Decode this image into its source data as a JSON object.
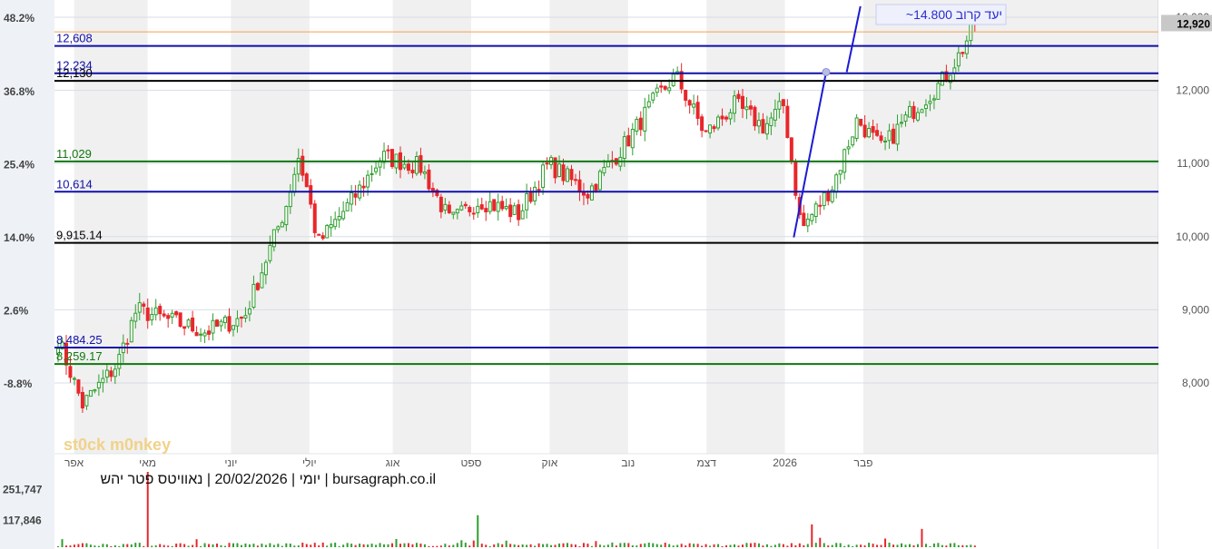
{
  "chart_data": {
    "type": "candlestick",
    "price_axis": {
      "ticks": [
        8000,
        9000,
        10000,
        11000,
        12000,
        13000
      ],
      "tick_labels": [
        "8,000",
        "9,000",
        "10,000",
        "11,000",
        "12,000",
        "13,000"
      ],
      "ylim": [
        7000,
        13100
      ]
    },
    "pct_axis": {
      "tick_labels": [
        "48.2%",
        "36.8%",
        "25.4%",
        "14.0%",
        "2.6%",
        "-8.8%"
      ],
      "tick_prices": [
        12985,
        11985,
        10985,
        9985,
        8985,
        7985
      ]
    },
    "x_axis_labels": [
      {
        "label": "אפר",
        "t": 0.02
      },
      {
        "label": "מאי",
        "t": 0.095
      },
      {
        "label": "יוני",
        "t": 0.18
      },
      {
        "label": "יולי",
        "t": 0.26
      },
      {
        "label": "אוג",
        "t": 0.345
      },
      {
        "label": "ספט",
        "t": 0.425
      },
      {
        "label": "אוק",
        "t": 0.505
      },
      {
        "label": "נוב",
        "t": 0.585
      },
      {
        "label": "דצמ",
        "t": 0.665
      },
      {
        "label": "2026",
        "t": 0.745
      },
      {
        "label": "פבר",
        "t": 0.825
      }
    ],
    "last_price": "12,920",
    "last_price_value": 12920,
    "horizontal_levels": [
      {
        "label": "12,608",
        "value": 12608,
        "color": "#1010a8"
      },
      {
        "label": "12,234",
        "value": 12234,
        "color": "#1010a8"
      },
      {
        "label": "12,130",
        "value": 12130,
        "color": "#000000"
      },
      {
        "label": "11,029",
        "value": 11029,
        "color": "#117711"
      },
      {
        "label": "10,614",
        "value": 10614,
        "color": "#1010a8"
      },
      {
        "label": "9,915.14",
        "value": 9915.14,
        "color": "#000000"
      },
      {
        "label": "8,484.25",
        "value": 8484.25,
        "color": "#1010a8"
      },
      {
        "label": "8,259.17",
        "value": 8259.17,
        "color": "#117711"
      }
    ],
    "target_label": "~יעד קרוב 14.800",
    "target_value": 14800,
    "trendline_points": [
      {
        "t": 0.754,
        "price": 9990
      },
      {
        "t": 0.787,
        "price": 12250
      }
    ],
    "trendline_2_points": [
      {
        "t": 0.808,
        "price": 12250
      },
      {
        "t": 0.822,
        "price": 13150
      }
    ],
    "anchors": [
      {
        "t": 0.0,
        "price": 8600
      },
      {
        "t": 0.025,
        "price": 7700
      },
      {
        "t": 0.06,
        "price": 8250
      },
      {
        "t": 0.08,
        "price": 9000
      },
      {
        "t": 0.15,
        "price": 8700
      },
      {
        "t": 0.19,
        "price": 8900
      },
      {
        "t": 0.215,
        "price": 9800
      },
      {
        "t": 0.232,
        "price": 10400
      },
      {
        "t": 0.245,
        "price": 11100
      },
      {
        "t": 0.255,
        "price": 10600
      },
      {
        "t": 0.265,
        "price": 9900
      },
      {
        "t": 0.3,
        "price": 10500
      },
      {
        "t": 0.33,
        "price": 11100
      },
      {
        "t": 0.37,
        "price": 10950
      },
      {
        "t": 0.4,
        "price": 10200
      },
      {
        "t": 0.43,
        "price": 10500
      },
      {
        "t": 0.47,
        "price": 10300
      },
      {
        "t": 0.5,
        "price": 11000
      },
      {
        "t": 0.54,
        "price": 10600
      },
      {
        "t": 0.58,
        "price": 11300
      },
      {
        "t": 0.61,
        "price": 11900
      },
      {
        "t": 0.63,
        "price": 12200
      },
      {
        "t": 0.66,
        "price": 11400
      },
      {
        "t": 0.69,
        "price": 11800
      },
      {
        "t": 0.72,
        "price": 11500
      },
      {
        "t": 0.74,
        "price": 11800
      },
      {
        "t": 0.758,
        "price": 10100
      },
      {
        "t": 0.79,
        "price": 10700
      },
      {
        "t": 0.815,
        "price": 11600
      },
      {
        "t": 0.84,
        "price": 11200
      },
      {
        "t": 0.87,
        "price": 11700
      },
      {
        "t": 0.9,
        "price": 12100
      },
      {
        "t": 0.92,
        "price": 12500
      },
      {
        "t": 0.935,
        "price": 12920
      }
    ],
    "volume_axis": {
      "tick_labels": [
        "251,747",
        "117,846"
      ],
      "tick_values": [
        251747,
        117846
      ],
      "ymax": 330000
    },
    "volume_spikes": [
      {
        "t": 0.093,
        "value": 330000,
        "up": false
      },
      {
        "t": 0.43,
        "value": 140000,
        "up": true
      },
      {
        "t": 0.77,
        "value": 100000,
        "up": false
      },
      {
        "t": 0.88,
        "value": 80000,
        "up": false
      }
    ],
    "caption": "יומי | 20/02/2026 | נאוויטס פטר יהש | bursagraph.co.il",
    "watermark": "st0ck m0nkey",
    "colors": {
      "up": "#2e9e2e",
      "down": "#e8262b",
      "grid": "#d7dde8",
      "axis_bg": "#eef2f7",
      "band": "#f0f0f0",
      "last_price_bg": "#c8c8c8",
      "orange_line": "#f0a050",
      "target_box": "#eef0fb",
      "target_text": "#2b2bd0"
    }
  }
}
